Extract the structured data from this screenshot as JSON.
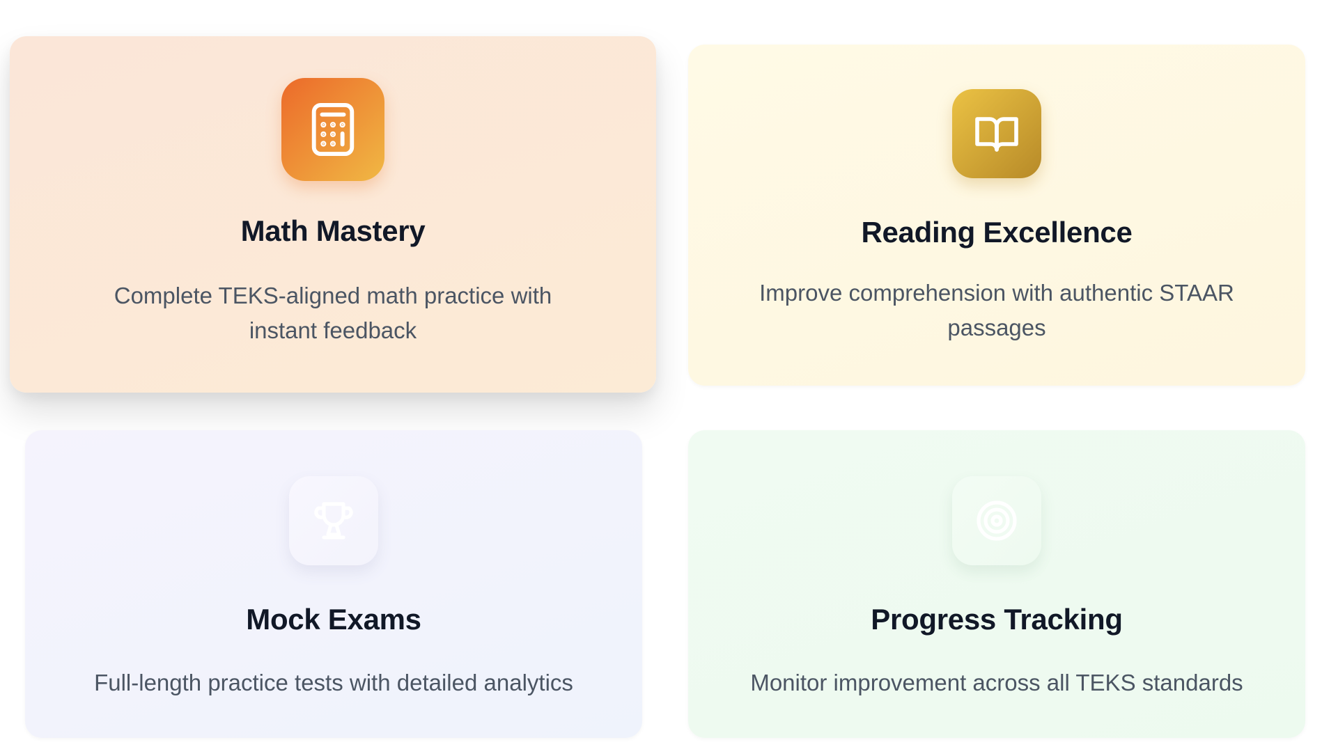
{
  "cards": [
    {
      "title": "Math Mastery",
      "description": "Complete TEKS-aligned math practice with instant feedback",
      "icon": "calculator-icon",
      "accent": "#ec6a2a"
    },
    {
      "title": "Reading Excellence",
      "description": "Improve comprehension with authentic STAAR passages",
      "icon": "book-open-icon",
      "accent": "#c79a30"
    },
    {
      "title": "Mock Exams",
      "description": "Full-length practice tests with detailed analytics",
      "icon": "trophy-icon",
      "accent": "#f5f3fd"
    },
    {
      "title": "Progress Tracking",
      "description": "Monitor improvement across all TEKS standards",
      "icon": "target-icon",
      "accent": "#f0fbf2"
    }
  ]
}
